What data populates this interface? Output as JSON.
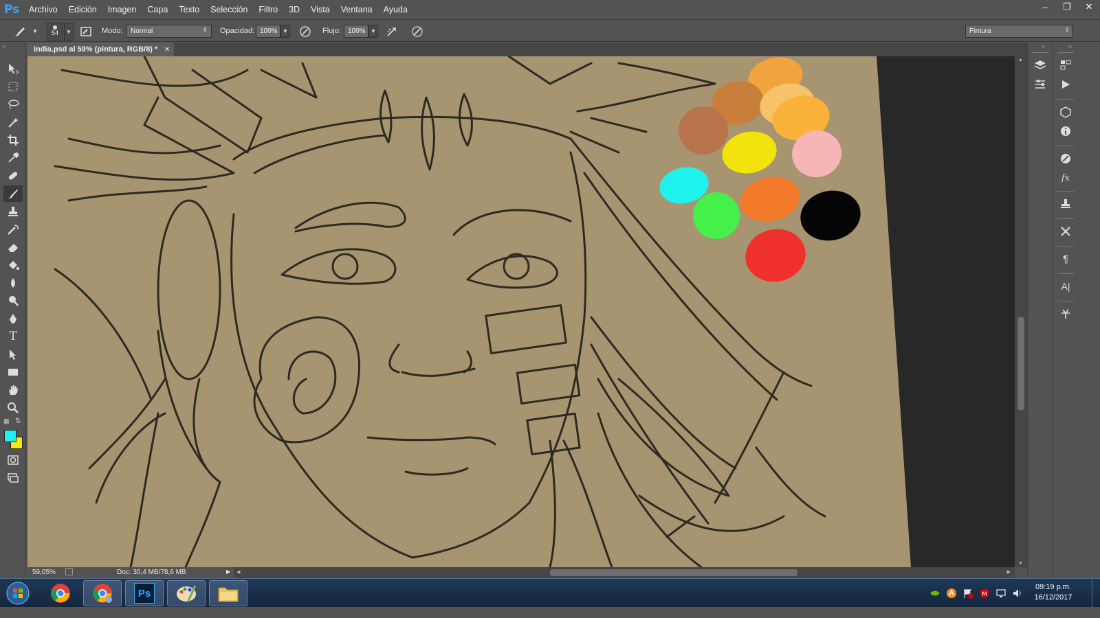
{
  "app": {
    "logo": "Ps"
  },
  "menu": [
    "Archivo",
    "Edición",
    "Imagen",
    "Capa",
    "Texto",
    "Selección",
    "Filtro",
    "3D",
    "Vista",
    "Ventana",
    "Ayuda"
  ],
  "options": {
    "brush_size": "54",
    "mode_label": "Modo:",
    "mode_value": "Normal",
    "opacity_label": "Opacidad:",
    "opacity_value": "100%",
    "flow_label": "Flujo:",
    "flow_value": "100%",
    "workspace": "Pintura"
  },
  "document": {
    "tab_title": "india.psd al 59% (pintura, RGB/8) *",
    "close": "×"
  },
  "status": {
    "zoom": "59,05%",
    "doc_info": "Doc: 30,4 MB/78,6 MB"
  },
  "colors": {
    "foreground": "#1ef2ee",
    "background": "#f1ea1c",
    "canvas": "#a69570"
  },
  "palette_swatches": [
    {
      "color": "#f3a33d"
    },
    {
      "color": "#c87f3b"
    },
    {
      "color": "#b9744c"
    },
    {
      "color": "#f7c36a"
    },
    {
      "color": "#fbb23a"
    },
    {
      "color": "#f2e30d"
    },
    {
      "color": "#f6b6b5"
    },
    {
      "color": "#1ff2ec"
    },
    {
      "color": "#f47a2c"
    },
    {
      "color": "#050505"
    },
    {
      "color": "#46f04a"
    },
    {
      "color": "#f0302c"
    }
  ],
  "taskbar": {
    "apps": [
      "start-orb",
      "chrome",
      "chrome-user",
      "photoshop",
      "paint",
      "explorer"
    ],
    "time": "09:19 p.m.",
    "date": "16/12/2017"
  }
}
